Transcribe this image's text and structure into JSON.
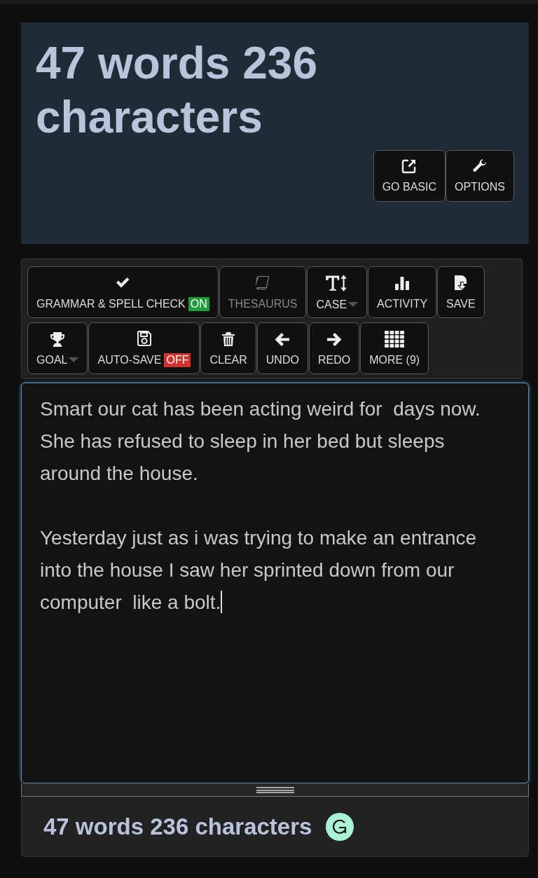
{
  "header": {
    "title": "47 words 236 characters",
    "buttons": [
      {
        "label": "GO BASIC",
        "kind": "external-link"
      },
      {
        "label": "OPTIONS",
        "kind": "wrench"
      }
    ]
  },
  "toolbar": {
    "buttons": [
      {
        "label": "GRAMMAR & SPELL CHECK",
        "kind": "check",
        "badge": {
          "text": "ON",
          "on": true
        },
        "dropdown": false,
        "disabled": false
      },
      {
        "label": "THESAURUS",
        "kind": "book",
        "dropdown": false,
        "disabled": true
      },
      {
        "label": "CASE",
        "kind": "text-height",
        "dropdown": true,
        "disabled": false
      },
      {
        "label": "ACTIVITY",
        "kind": "bar-chart",
        "dropdown": false,
        "disabled": false
      },
      {
        "label": "SAVE",
        "kind": "file-download",
        "dropdown": false,
        "disabled": false
      },
      {
        "label": "GOAL",
        "kind": "trophy",
        "dropdown": true,
        "disabled": false
      },
      {
        "label": "AUTO-SAVE",
        "kind": "floppy",
        "badge": {
          "text": "OFF",
          "on": false
        },
        "dropdown": false,
        "disabled": false
      },
      {
        "label": "CLEAR",
        "kind": "trash",
        "dropdown": false,
        "disabled": false
      },
      {
        "label": "UNDO",
        "kind": "arrow-left",
        "dropdown": false,
        "disabled": false
      },
      {
        "label": "REDO",
        "kind": "arrow-right",
        "dropdown": false,
        "disabled": false
      },
      {
        "label": "MORE (9)",
        "kind": "grid",
        "dropdown": false,
        "disabled": false
      }
    ]
  },
  "editor": {
    "paragraphs": [
      "Smart our cat has been acting weird for  days now. She has refused to sleep in her bed but sleeps around the house.",
      "Yesterday just as i was trying to make an entrance into the house I saw her sprinted down from our computer  like a bolt."
    ],
    "focused": true
  },
  "footer": {
    "count": "47 words 236 characters"
  }
}
